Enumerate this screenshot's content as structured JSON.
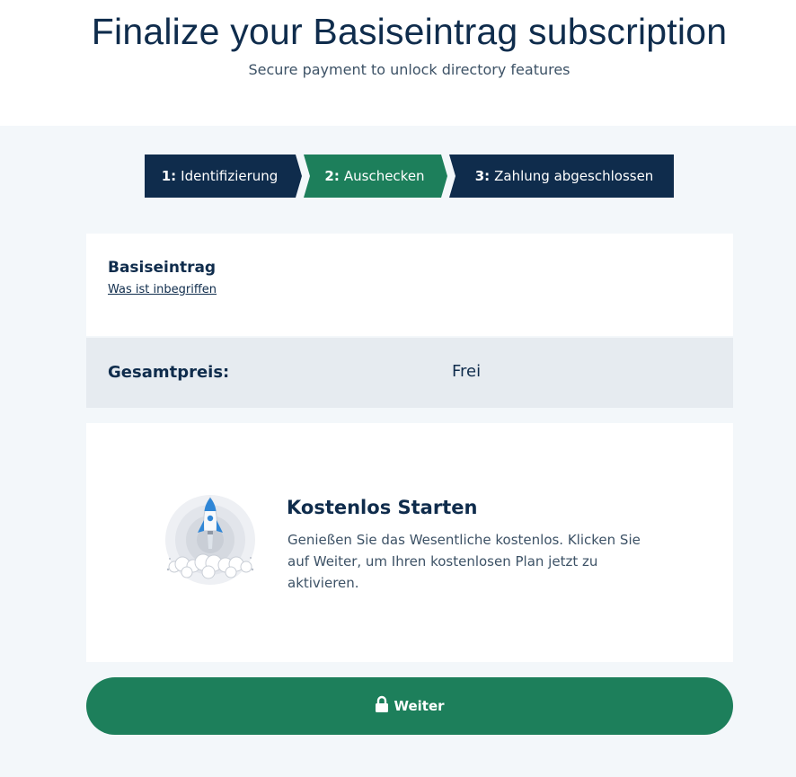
{
  "header": {
    "title": "Finalize your Basiseintrag subscription",
    "subtitle": "Secure payment to unlock directory features"
  },
  "stepper": {
    "steps": [
      {
        "number": "1:",
        "label": "Identifizierung",
        "state": "done"
      },
      {
        "number": "2:",
        "label": "Auschecken",
        "state": "active"
      },
      {
        "number": "3:",
        "label": "Zahlung abgeschlossen",
        "state": "pending"
      }
    ]
  },
  "plan": {
    "name": "Basiseintrag",
    "details_link": "Was ist inbegriffen"
  },
  "total": {
    "label": "Gesamtpreis:",
    "value": "Frei"
  },
  "info": {
    "icon": "rocket-icon",
    "title": "Kostenlos Starten",
    "text": "Genießen Sie das Wesentliche kostenlos. Klicken Sie auf Weiter, um Ihren kostenlosen Plan jetzt zu aktivieren."
  },
  "action": {
    "icon": "lock-icon",
    "label": "Weiter"
  },
  "colors": {
    "navy": "#0f2c4c",
    "green": "#1d7f5b",
    "page_bg": "#f3f7fa",
    "total_bg": "#e6ebf0"
  }
}
